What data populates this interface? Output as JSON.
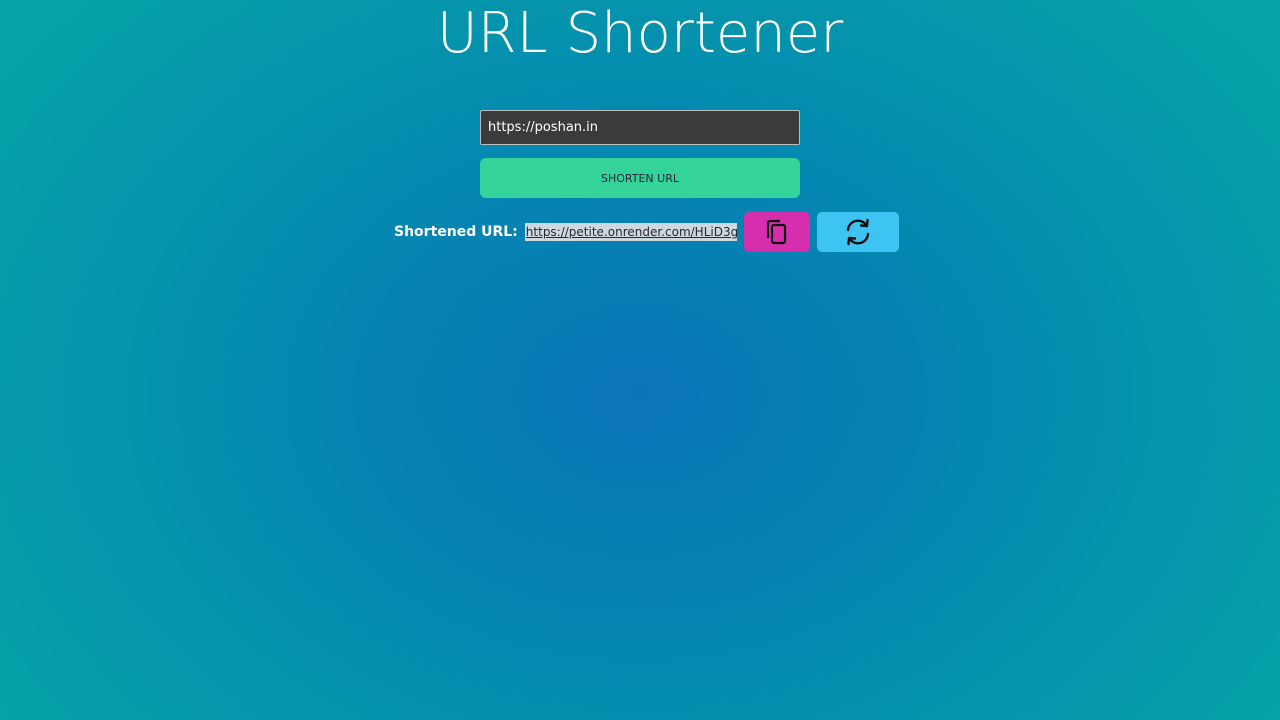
{
  "app": {
    "title": "URL Shortener"
  },
  "form": {
    "input_value": "https://poshan.in",
    "shorten_label": "SHORTEN URL"
  },
  "result": {
    "label": "Shortened URL:",
    "link": "https://petite.onrender.com/HLiD3g",
    "copy_icon": "copy-icon",
    "refresh_icon": "refresh-icon"
  },
  "colors": {
    "background_center": "#0a74b8",
    "background_edge": "#06a3a8",
    "input_bg": "#3b3b3b",
    "shorten_button": "#34d399",
    "copy_button": "#d62fae",
    "refresh_button": "#3ec4f2"
  }
}
